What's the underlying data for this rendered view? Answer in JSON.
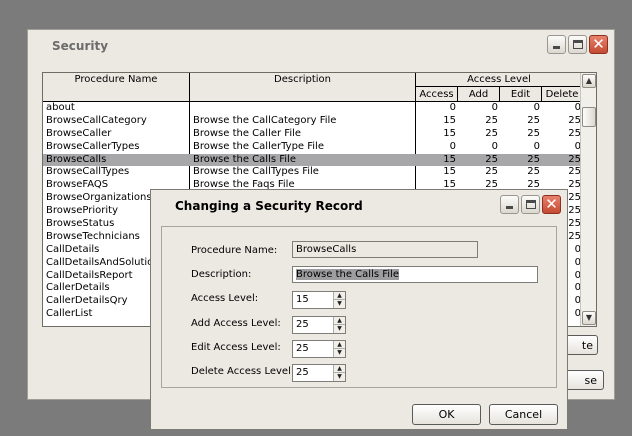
{
  "security_window": {
    "title": "Security",
    "columns": {
      "procedure": "Procedure Name",
      "description": "Description",
      "access_level": "Access Level",
      "access": "Access",
      "add": "Add",
      "edit": "Edit",
      "delete": "Delete"
    },
    "rows": [
      {
        "proc": "about",
        "desc": "",
        "access": "0",
        "add": "0",
        "edit": "0",
        "del": "0"
      },
      {
        "proc": "BrowseCallCategory",
        "desc": "Browse the CallCategory File",
        "access": "15",
        "add": "25",
        "edit": "25",
        "del": "25"
      },
      {
        "proc": "BrowseCaller",
        "desc": "Browse the Caller File",
        "access": "15",
        "add": "25",
        "edit": "25",
        "del": "25"
      },
      {
        "proc": "BrowseCallerTypes",
        "desc": "Browse the CallerType File",
        "access": "0",
        "add": "0",
        "edit": "0",
        "del": "0"
      },
      {
        "proc": "BrowseCalls",
        "desc": "Browse the Calls File",
        "access": "15",
        "add": "25",
        "edit": "25",
        "del": "25"
      },
      {
        "proc": "BrowseCallTypes",
        "desc": "Browse the CallTypes File",
        "access": "15",
        "add": "25",
        "edit": "25",
        "del": "25"
      },
      {
        "proc": "BrowseFAQS",
        "desc": "Browse the Faqs File",
        "access": "15",
        "add": "25",
        "edit": "25",
        "del": "25"
      },
      {
        "proc": "BrowseOrganizations",
        "desc": "",
        "access": "",
        "add": "",
        "edit": "",
        "del": "25"
      },
      {
        "proc": "BrowsePriority",
        "desc": "",
        "access": "",
        "add": "",
        "edit": "",
        "del": "25"
      },
      {
        "proc": "BrowseStatus",
        "desc": "",
        "access": "",
        "add": "",
        "edit": "",
        "del": "25"
      },
      {
        "proc": "BrowseTechnicians",
        "desc": "",
        "access": "",
        "add": "",
        "edit": "",
        "del": "25"
      },
      {
        "proc": "CallDetails",
        "desc": "",
        "access": "",
        "add": "",
        "edit": "",
        "del": "0"
      },
      {
        "proc": "CallDetailsAndSolution",
        "desc": "",
        "access": "",
        "add": "",
        "edit": "",
        "del": "0"
      },
      {
        "proc": "CallDetailsReport",
        "desc": "",
        "access": "",
        "add": "",
        "edit": "",
        "del": "0"
      },
      {
        "proc": "CallerDetails",
        "desc": "",
        "access": "",
        "add": "",
        "edit": "",
        "del": "0"
      },
      {
        "proc": "CallerDetailsQry",
        "desc": "",
        "access": "",
        "add": "",
        "edit": "",
        "del": "0"
      },
      {
        "proc": "CallerList",
        "desc": "",
        "access": "",
        "add": "",
        "edit": "",
        "del": "0"
      }
    ],
    "buttons": {
      "btn1_partial": "te",
      "btn2_partial": "se"
    }
  },
  "dialog": {
    "title": "Changing a Security Record",
    "labels": {
      "procedure": "Procedure Name:",
      "description": "Description:",
      "access": "Access Level:",
      "add": "Add Access Level:",
      "edit": "Edit Access Level:",
      "delete": "Delete Access Level:"
    },
    "values": {
      "procedure": "BrowseCalls",
      "description": "Browse the Calls File",
      "access": "15",
      "add": "25",
      "edit": "25",
      "delete": "25"
    },
    "ok": "OK",
    "cancel": "Cancel"
  }
}
